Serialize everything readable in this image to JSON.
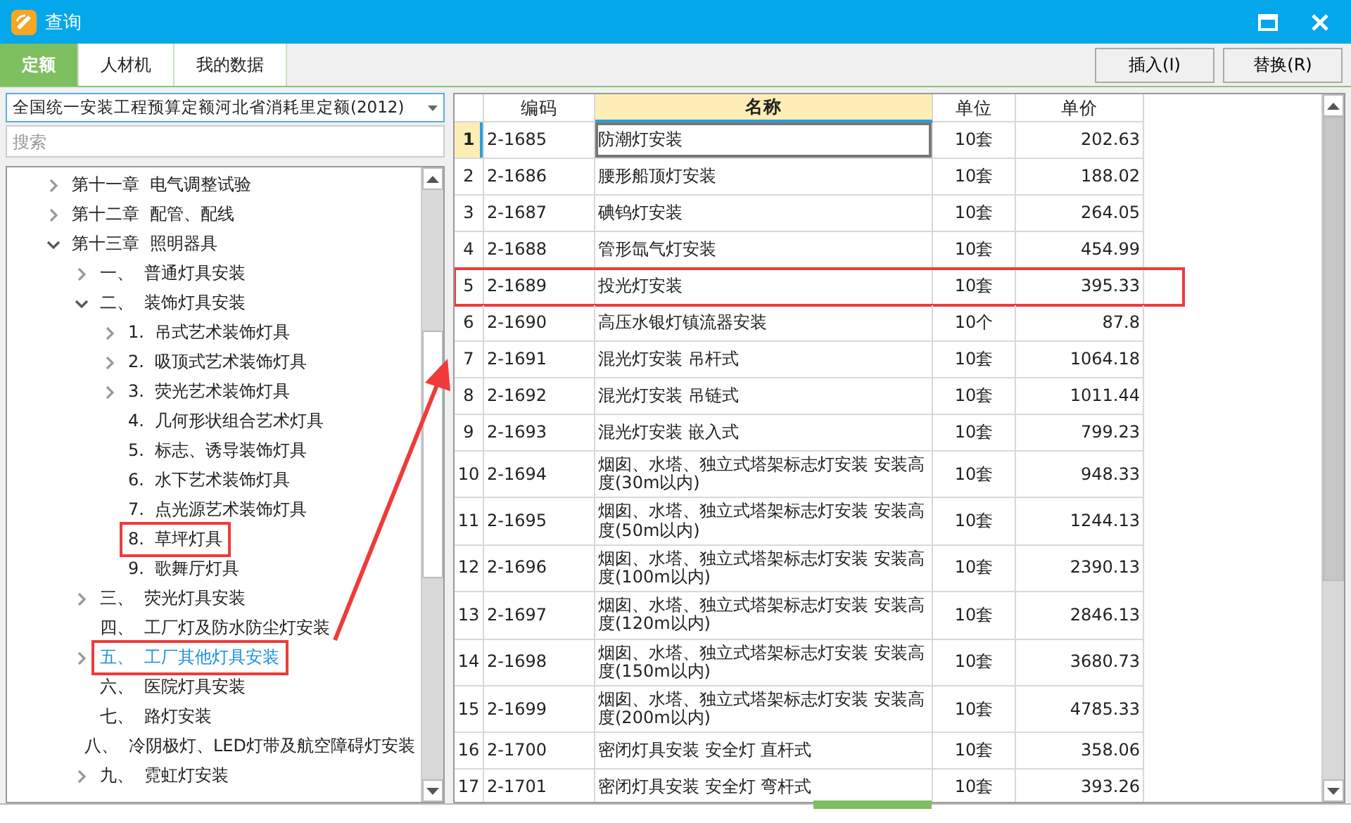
{
  "window": {
    "title": "查询"
  },
  "tabs": [
    {
      "label": "定额",
      "selected": true
    },
    {
      "label": "人材机",
      "selected": false
    },
    {
      "label": "我的数据",
      "selected": false
    }
  ],
  "actions": [
    "插入(I)",
    "替换(R)"
  ],
  "library": {
    "value": "全国统一安装工程预算定额河北省消耗里定额(2012)"
  },
  "search": {
    "placeholder": "搜索"
  },
  "tree": [
    {
      "label": "第十一章  电气调整试验",
      "expanded": false,
      "selected": false
    },
    {
      "label": "第十二章  配管、配线",
      "expanded": false,
      "selected": false
    },
    {
      "label": "第十三章  照明器具",
      "expanded": true,
      "selected": false,
      "children": [
        {
          "label": "一、  普通灯具安装",
          "expanded": false,
          "selected": false
        },
        {
          "label": "二、  装饰灯具安装",
          "expanded": true,
          "selected": false,
          "children": [
            {
              "label": "1.  吊式艺术装饰灯具",
              "expanded": false,
              "selected": false
            },
            {
              "label": "2.  吸顶式艺术装饰灯具",
              "expanded": false,
              "selected": false
            },
            {
              "label": "3.  荧光艺术装饰灯具",
              "expanded": false,
              "selected": false
            },
            {
              "label": "4.  几何形状组合艺术灯具",
              "selected": false
            },
            {
              "label": "5.  标志、诱导装饰灯具",
              "selected": false
            },
            {
              "label": "6.  水下艺术装饰灯具",
              "selected": false
            },
            {
              "label": "7.  点光源艺术装饰灯具",
              "selected": false
            },
            {
              "label": "8.  草坪灯具",
              "selected": false,
              "highlighted": true
            },
            {
              "label": "9.  歌舞厅灯具",
              "selected": false
            }
          ]
        },
        {
          "label": "三、  荧光灯具安装",
          "expanded": false,
          "selected": false
        },
        {
          "label": "四、  工厂灯及防水防尘灯安装",
          "selected": false
        },
        {
          "label": "五、  工厂其他灯具安装",
          "expanded": false,
          "selected": true,
          "highlighted": true
        },
        {
          "label": "六、  医院灯具安装",
          "selected": false
        },
        {
          "label": "七、  路灯安装",
          "selected": false
        },
        {
          "label": "八、  冷阴极灯、LED灯带及航空障碍灯安装",
          "selected": false
        },
        {
          "label": "九、  霓虹灯安装",
          "expanded": false,
          "selected": false
        }
      ]
    }
  ],
  "table": {
    "columns": [
      {
        "label": "编码",
        "selected": false
      },
      {
        "label": "名称",
        "selected": true
      },
      {
        "label": "单位",
        "selected": false
      },
      {
        "label": "单价",
        "selected": false
      }
    ],
    "rows": [
      {
        "no": "1",
        "code": "2-1685",
        "name": "防潮灯安装",
        "unit": "10套",
        "price": "202.63",
        "selected": true
      },
      {
        "no": "2",
        "code": "2-1686",
        "name": "腰形船顶灯安装",
        "unit": "10套",
        "price": "188.02",
        "selected": false
      },
      {
        "no": "3",
        "code": "2-1687",
        "name": "碘钨灯安装",
        "unit": "10套",
        "price": "264.05",
        "selected": false
      },
      {
        "no": "4",
        "code": "2-1688",
        "name": "管形氙气灯安装",
        "unit": "10套",
        "price": "454.99",
        "selected": false
      },
      {
        "no": "5",
        "code": "2-1689",
        "name": "投光灯安装",
        "unit": "10套",
        "price": "395.33",
        "selected": false,
        "highlighted": true
      },
      {
        "no": "6",
        "code": "2-1690",
        "name": "高压水银灯镇流器安装",
        "unit": "10个",
        "price": "87.8",
        "selected": false
      },
      {
        "no": "7",
        "code": "2-1691",
        "name": "混光灯安装 吊杆式",
        "unit": "10套",
        "price": "1064.18",
        "selected": false
      },
      {
        "no": "8",
        "code": "2-1692",
        "name": "混光灯安装 吊链式",
        "unit": "10套",
        "price": "1011.44",
        "selected": false
      },
      {
        "no": "9",
        "code": "2-1693",
        "name": "混光灯安装 嵌入式",
        "unit": "10套",
        "price": "799.23",
        "selected": false
      },
      {
        "no": "10",
        "code": "2-1694",
        "name": "烟囱、水塔、独立式塔架标志灯安装 安装高度(30m以内)",
        "unit": "10套",
        "price": "948.33",
        "selected": false
      },
      {
        "no": "11",
        "code": "2-1695",
        "name": "烟囱、水塔、独立式塔架标志灯安装 安装高度(50m以内)",
        "unit": "10套",
        "price": "1244.13",
        "selected": false
      },
      {
        "no": "12",
        "code": "2-1696",
        "name": "烟囱、水塔、独立式塔架标志灯安装 安装高度(100m以内)",
        "unit": "10套",
        "price": "2390.13",
        "selected": false
      },
      {
        "no": "13",
        "code": "2-1697",
        "name": "烟囱、水塔、独立式塔架标志灯安装 安装高度(120m以内)",
        "unit": "10套",
        "price": "2846.13",
        "selected": false
      },
      {
        "no": "14",
        "code": "2-1698",
        "name": "烟囱、水塔、独立式塔架标志灯安装 安装高度(150m以内)",
        "unit": "10套",
        "price": "3680.73",
        "selected": false
      },
      {
        "no": "15",
        "code": "2-1699",
        "name": "烟囱、水塔、独立式塔架标志灯安装 安装高度(200m以内)",
        "unit": "10套",
        "price": "4785.33",
        "selected": false
      },
      {
        "no": "16",
        "code": "2-1700",
        "name": "密闭灯具安装 安全灯 直杆式",
        "unit": "10套",
        "price": "358.06",
        "selected": false
      },
      {
        "no": "17",
        "code": "2-1701",
        "name": "密闭灯具安装 安全灯 弯杆式",
        "unit": "10套",
        "price": "393.26",
        "selected": false
      }
    ]
  }
}
